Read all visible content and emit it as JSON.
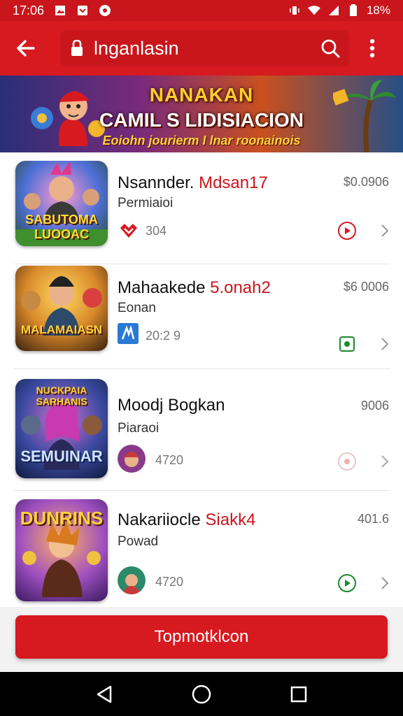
{
  "status_bar": {
    "time": "17:06",
    "battery": "18%"
  },
  "app_bar": {
    "search_text": "lnganlasin"
  },
  "banner": {
    "title": "NANAKAN",
    "subtitle": "CAMIL S LIDISIACION",
    "tagline": "Eoiohn jourierm I lnar roonainois"
  },
  "items": [
    {
      "title_plain": "Nsannder. ",
      "title_accent": "Mdsan17",
      "subtitle": "Permiaioi",
      "price": "$0.0906",
      "meta": "304",
      "thumb_label": "SABUTOMA LUOOAC",
      "accent_color": "#d71920"
    },
    {
      "title_plain": "Mahaakede ",
      "title_accent": "5.onah2",
      "subtitle": "Eonan",
      "price": "$6 0006",
      "meta": "20:2 9",
      "thumb_label": "MALAMAIASN",
      "accent_color": "#1a8a2a"
    },
    {
      "title_plain": "Moodj Bogkan",
      "title_accent": "",
      "subtitle": "Piaraoi",
      "price": "9006",
      "meta": "4720",
      "thumb_label": "SEMUINAR",
      "accent_color": "#d71920"
    },
    {
      "title_plain": "Nakariiocle ",
      "title_accent": "Siakk4",
      "subtitle": "Powad",
      "price": "401.6",
      "meta": "4720",
      "thumb_label": "DUNRINS",
      "accent_color": "#1a8a2a"
    }
  ],
  "cta": {
    "label": "Topmotklcon"
  },
  "colors": {
    "brand": "#d71920",
    "green": "#1a8a2a"
  }
}
